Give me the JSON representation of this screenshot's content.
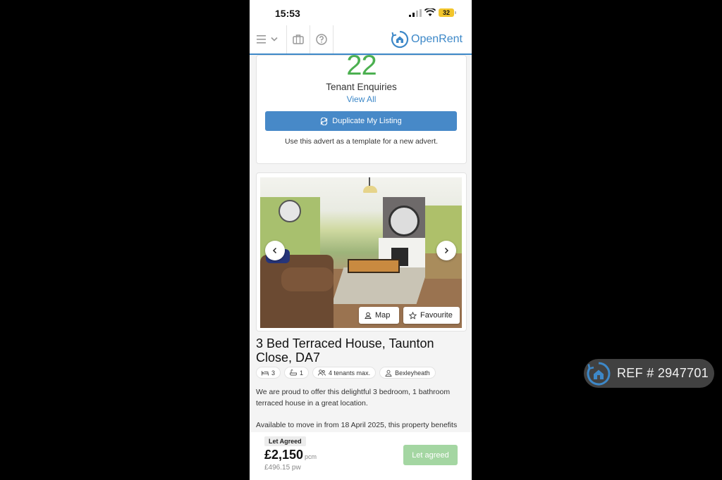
{
  "status_bar": {
    "time": "15:53",
    "battery": "32"
  },
  "brand": {
    "name": "OpenRent",
    "accent_color": "#3d88c8"
  },
  "nav": {
    "icons": [
      "menu-icon",
      "chevron-down-icon",
      "briefcase-icon",
      "help-icon"
    ]
  },
  "enquiries": {
    "count": "22",
    "label": "Tenant Enquiries",
    "view_all": "View All",
    "duplicate_button": "Duplicate My Listing",
    "caption": "Use this advert as a template for a new advert."
  },
  "listing": {
    "photo_buttons": {
      "map": "Map",
      "favourite": "Favourite"
    },
    "title": "3 Bed Terraced House, Taunton Close, DA7",
    "chips": {
      "bedrooms": "3",
      "bathrooms": "1",
      "tenants": "4 tenants max.",
      "location": "Bexleyheath"
    },
    "description_1": "We are proud to offer this delightful 3 bedroom, 1 bathroom terraced house in a great location.",
    "description_2": "Available to move in from 18 April 2025, this property benefits"
  },
  "price_bar": {
    "badge": "Let Agreed",
    "price": "£2,150",
    "unit": "pcm",
    "weekly": "£496.15 pw",
    "button": "Let agreed"
  },
  "watermark": {
    "ref": "REF # 2947701"
  }
}
